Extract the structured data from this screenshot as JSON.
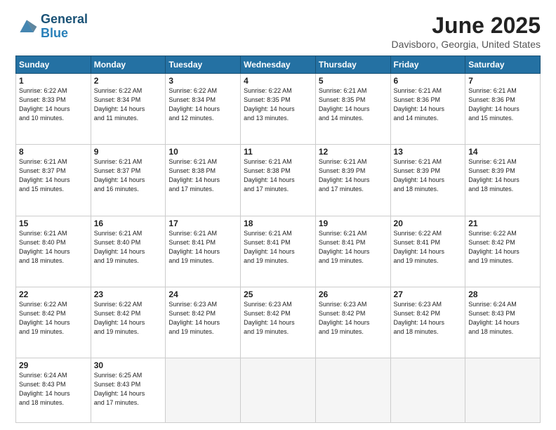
{
  "logo": {
    "line1": "General",
    "line2": "Blue"
  },
  "title": "June 2025",
  "subtitle": "Davisboro, Georgia, United States",
  "weekdays": [
    "Sunday",
    "Monday",
    "Tuesday",
    "Wednesday",
    "Thursday",
    "Friday",
    "Saturday"
  ],
  "weeks": [
    [
      {
        "day": "1",
        "info": "Sunrise: 6:22 AM\nSunset: 8:33 PM\nDaylight: 14 hours\nand 10 minutes."
      },
      {
        "day": "2",
        "info": "Sunrise: 6:22 AM\nSunset: 8:34 PM\nDaylight: 14 hours\nand 11 minutes."
      },
      {
        "day": "3",
        "info": "Sunrise: 6:22 AM\nSunset: 8:34 PM\nDaylight: 14 hours\nand 12 minutes."
      },
      {
        "day": "4",
        "info": "Sunrise: 6:22 AM\nSunset: 8:35 PM\nDaylight: 14 hours\nand 13 minutes."
      },
      {
        "day": "5",
        "info": "Sunrise: 6:21 AM\nSunset: 8:35 PM\nDaylight: 14 hours\nand 14 minutes."
      },
      {
        "day": "6",
        "info": "Sunrise: 6:21 AM\nSunset: 8:36 PM\nDaylight: 14 hours\nand 14 minutes."
      },
      {
        "day": "7",
        "info": "Sunrise: 6:21 AM\nSunset: 8:36 PM\nDaylight: 14 hours\nand 15 minutes."
      }
    ],
    [
      {
        "day": "8",
        "info": "Sunrise: 6:21 AM\nSunset: 8:37 PM\nDaylight: 14 hours\nand 15 minutes."
      },
      {
        "day": "9",
        "info": "Sunrise: 6:21 AM\nSunset: 8:37 PM\nDaylight: 14 hours\nand 16 minutes."
      },
      {
        "day": "10",
        "info": "Sunrise: 6:21 AM\nSunset: 8:38 PM\nDaylight: 14 hours\nand 17 minutes."
      },
      {
        "day": "11",
        "info": "Sunrise: 6:21 AM\nSunset: 8:38 PM\nDaylight: 14 hours\nand 17 minutes."
      },
      {
        "day": "12",
        "info": "Sunrise: 6:21 AM\nSunset: 8:39 PM\nDaylight: 14 hours\nand 17 minutes."
      },
      {
        "day": "13",
        "info": "Sunrise: 6:21 AM\nSunset: 8:39 PM\nDaylight: 14 hours\nand 18 minutes."
      },
      {
        "day": "14",
        "info": "Sunrise: 6:21 AM\nSunset: 8:39 PM\nDaylight: 14 hours\nand 18 minutes."
      }
    ],
    [
      {
        "day": "15",
        "info": "Sunrise: 6:21 AM\nSunset: 8:40 PM\nDaylight: 14 hours\nand 18 minutes."
      },
      {
        "day": "16",
        "info": "Sunrise: 6:21 AM\nSunset: 8:40 PM\nDaylight: 14 hours\nand 19 minutes."
      },
      {
        "day": "17",
        "info": "Sunrise: 6:21 AM\nSunset: 8:41 PM\nDaylight: 14 hours\nand 19 minutes."
      },
      {
        "day": "18",
        "info": "Sunrise: 6:21 AM\nSunset: 8:41 PM\nDaylight: 14 hours\nand 19 minutes."
      },
      {
        "day": "19",
        "info": "Sunrise: 6:21 AM\nSunset: 8:41 PM\nDaylight: 14 hours\nand 19 minutes."
      },
      {
        "day": "20",
        "info": "Sunrise: 6:22 AM\nSunset: 8:41 PM\nDaylight: 14 hours\nand 19 minutes."
      },
      {
        "day": "21",
        "info": "Sunrise: 6:22 AM\nSunset: 8:42 PM\nDaylight: 14 hours\nand 19 minutes."
      }
    ],
    [
      {
        "day": "22",
        "info": "Sunrise: 6:22 AM\nSunset: 8:42 PM\nDaylight: 14 hours\nand 19 minutes."
      },
      {
        "day": "23",
        "info": "Sunrise: 6:22 AM\nSunset: 8:42 PM\nDaylight: 14 hours\nand 19 minutes."
      },
      {
        "day": "24",
        "info": "Sunrise: 6:23 AM\nSunset: 8:42 PM\nDaylight: 14 hours\nand 19 minutes."
      },
      {
        "day": "25",
        "info": "Sunrise: 6:23 AM\nSunset: 8:42 PM\nDaylight: 14 hours\nand 19 minutes."
      },
      {
        "day": "26",
        "info": "Sunrise: 6:23 AM\nSunset: 8:42 PM\nDaylight: 14 hours\nand 19 minutes."
      },
      {
        "day": "27",
        "info": "Sunrise: 6:23 AM\nSunset: 8:42 PM\nDaylight: 14 hours\nand 18 minutes."
      },
      {
        "day": "28",
        "info": "Sunrise: 6:24 AM\nSunset: 8:43 PM\nDaylight: 14 hours\nand 18 minutes."
      }
    ],
    [
      {
        "day": "29",
        "info": "Sunrise: 6:24 AM\nSunset: 8:43 PM\nDaylight: 14 hours\nand 18 minutes."
      },
      {
        "day": "30",
        "info": "Sunrise: 6:25 AM\nSunset: 8:43 PM\nDaylight: 14 hours\nand 17 minutes."
      },
      {
        "day": "",
        "info": ""
      },
      {
        "day": "",
        "info": ""
      },
      {
        "day": "",
        "info": ""
      },
      {
        "day": "",
        "info": ""
      },
      {
        "day": "",
        "info": ""
      }
    ]
  ]
}
